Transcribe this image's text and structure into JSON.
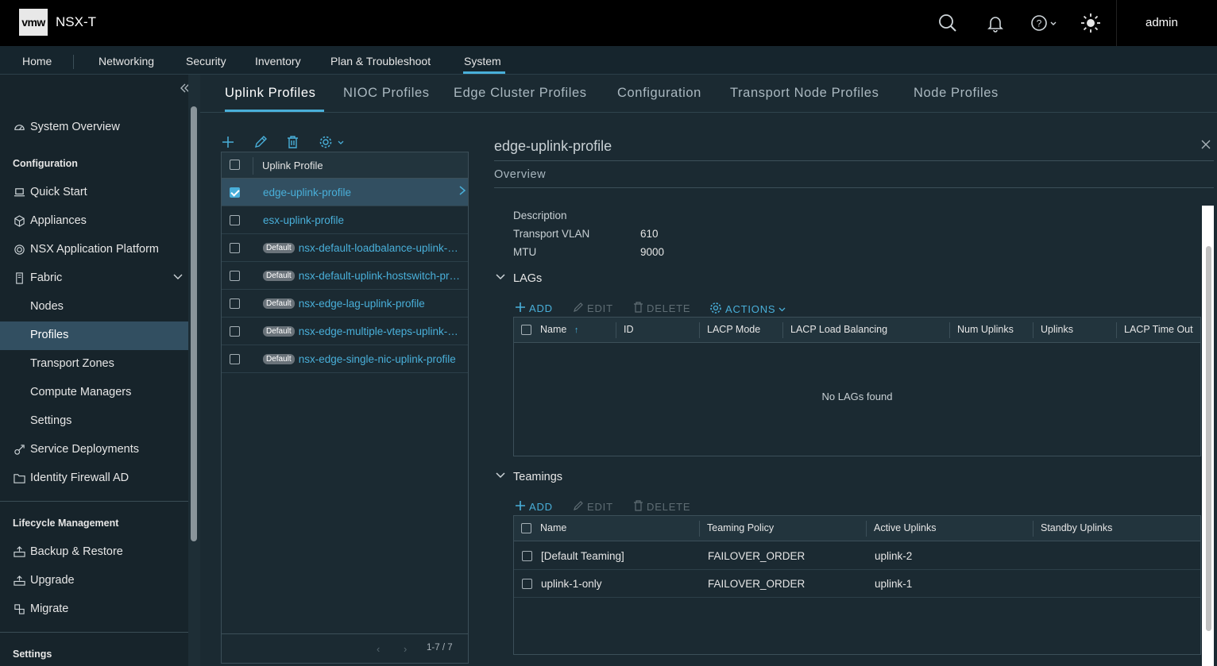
{
  "header": {
    "logo": "vmw",
    "app_title": "NSX-T",
    "user": "admin"
  },
  "topnav": {
    "items": [
      "Home",
      "Networking",
      "Security",
      "Inventory",
      "Plan & Troubleshoot",
      "System"
    ],
    "active": "System"
  },
  "sidebar": {
    "system_overview": "System Overview",
    "config_header": "Configuration",
    "quick_start": "Quick Start",
    "appliances": "Appliances",
    "nsx_app_platform": "NSX Application Platform",
    "fabric": "Fabric",
    "nodes": "Nodes",
    "profiles": "Profiles",
    "transport_zones": "Transport Zones",
    "compute_managers": "Compute Managers",
    "settings": "Settings",
    "service_deployments": "Service Deployments",
    "identity_firewall": "Identity Firewall AD",
    "lifecycle_header": "Lifecycle Management",
    "backup_restore": "Backup & Restore",
    "upgrade": "Upgrade",
    "migrate": "Migrate",
    "settings_header": "Settings"
  },
  "subtabs": [
    "Uplink Profiles",
    "NIOC Profiles",
    "Edge Cluster Profiles",
    "Configuration",
    "Transport Node Profiles",
    "Node Profiles"
  ],
  "profile_list": {
    "column": "Uplink Profile",
    "default_badge": "Default",
    "rows": [
      {
        "name": "edge-uplink-profile",
        "default": false,
        "selected": true
      },
      {
        "name": "esx-uplink-profile",
        "default": false,
        "selected": false
      },
      {
        "name": "nsx-default-loadbalance-uplink-hostswitch-profile",
        "default": true,
        "selected": false
      },
      {
        "name": "nsx-default-uplink-hostswitch-profile",
        "default": true,
        "selected": false
      },
      {
        "name": "nsx-edge-lag-uplink-profile",
        "default": true,
        "selected": false
      },
      {
        "name": "nsx-edge-multiple-vteps-uplink-profile",
        "default": true,
        "selected": false
      },
      {
        "name": "nsx-edge-single-nic-uplink-profile",
        "default": true,
        "selected": false
      }
    ],
    "pager": "1-7 / 7"
  },
  "detail": {
    "title": "edge-uplink-profile",
    "overview": "Overview",
    "props": {
      "description_label": "Description",
      "vlan_label": "Transport VLAN",
      "vlan_value": "610",
      "mtu_label": "MTU",
      "mtu_value": "9000"
    },
    "lags": {
      "title": "LAGs",
      "add": "ADD",
      "edit": "EDIT",
      "delete": "DELETE",
      "actions": "ACTIONS",
      "columns": [
        "Name",
        "ID",
        "LACP Mode",
        "LACP Load Balancing",
        "Num Uplinks",
        "Uplinks",
        "LACP Time Out"
      ],
      "empty": "No LAGs found"
    },
    "teamings": {
      "title": "Teamings",
      "add": "ADD",
      "edit": "EDIT",
      "delete": "DELETE",
      "columns": [
        "Name",
        "Teaming Policy",
        "Active Uplinks",
        "Standby Uplinks"
      ],
      "rows": [
        {
          "name": "[Default Teaming]",
          "policy": "FAILOVER_ORDER",
          "active": "uplink-2",
          "standby": ""
        },
        {
          "name": "uplink-1-only",
          "policy": "FAILOVER_ORDER",
          "active": "uplink-1",
          "standby": ""
        }
      ]
    }
  },
  "colors": {
    "accent": "#49afd9",
    "header_bg": "#000000",
    "page_bg": "#1b2a32",
    "selected_bg": "#324f61"
  }
}
